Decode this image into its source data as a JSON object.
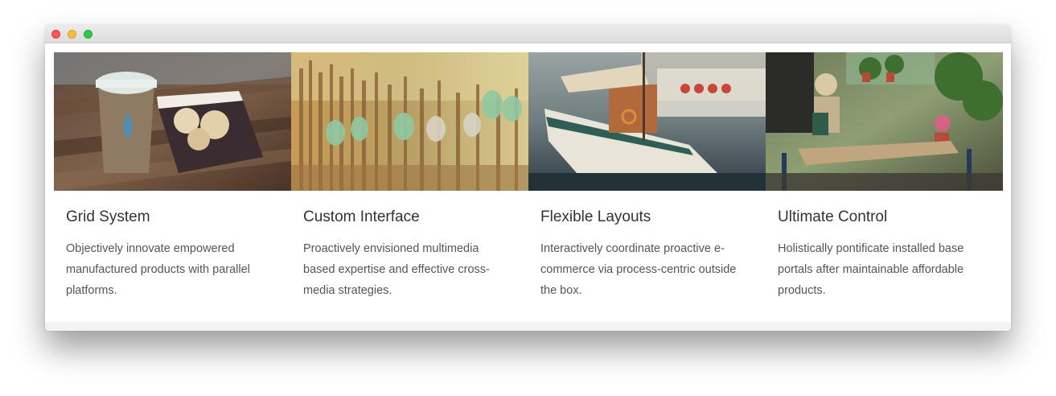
{
  "window": {
    "controls": [
      "close",
      "minimize",
      "zoom"
    ]
  },
  "features": [
    {
      "image": "coffee-cup-macarons-photo",
      "title": "Grid System",
      "text": "Objectively innovate empowered manufactured products with parallel platforms."
    },
    {
      "image": "fence-bottles-photo",
      "title": "Custom Interface",
      "text": "Proactively envisioned multimedia based expertise and effective cross-media strategies."
    },
    {
      "image": "sailboat-harbor-photo",
      "title": "Flexible Layouts",
      "text": "Interactively coordinate proactive e-commerce via process-centric outside the box."
    },
    {
      "image": "street-cafe-photo",
      "title": "Ultimate Control",
      "text": "Holistically pontificate installed base portals after maintainable affordable products."
    }
  ]
}
